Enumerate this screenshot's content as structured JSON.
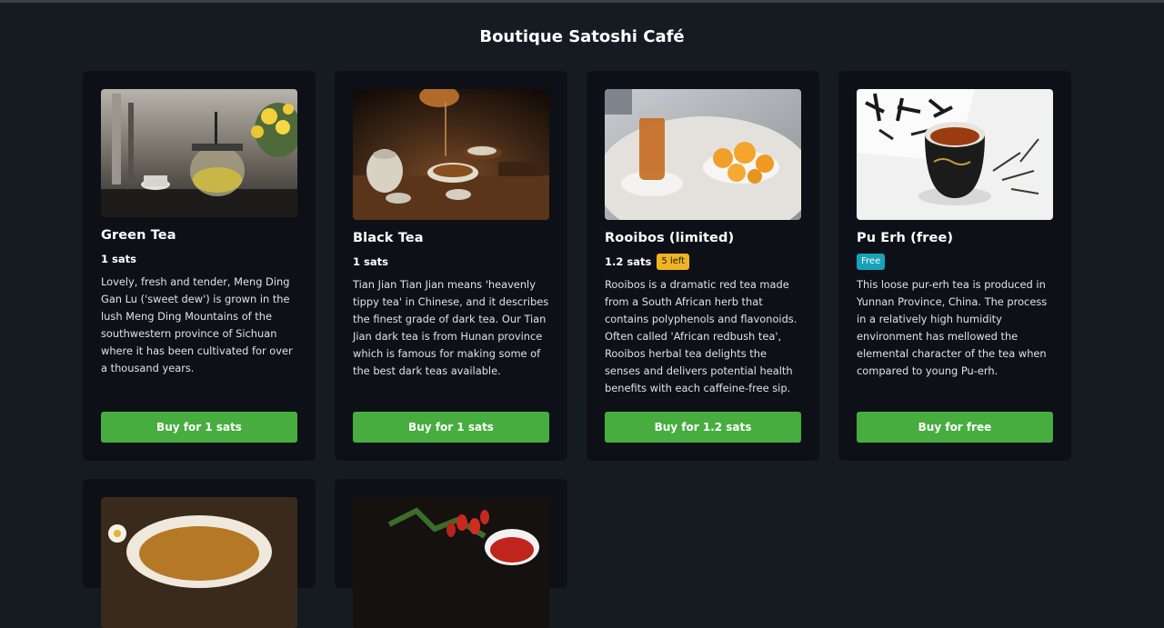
{
  "page": {
    "title": "Boutique Satoshi Café"
  },
  "products": [
    {
      "name": "Green Tea",
      "price": "1 sats",
      "badge": "",
      "description": "Lovely, fresh and tender, Meng Ding Gan Lu ('sweet dew') is grown in the lush Meng Ding Mountains of the southwestern province of Sichuan where it has been cultivated for over a thousand years.",
      "button": "Buy for 1 sats"
    },
    {
      "name": "Black Tea",
      "price": "1 sats",
      "badge": "",
      "description": "Tian Jian Tian Jian means 'heavenly tippy tea' in Chinese, and it describes the finest grade of dark tea. Our Tian Jian dark tea is from Hunan province which is famous for making some of the best dark teas available.",
      "button": "Buy for 1 sats"
    },
    {
      "name": "Rooibos (limited)",
      "price": "1.2 sats",
      "badge": "5 left",
      "description": "Rooibos is a dramatic red tea made from a South African herb that contains polyphenols and flavonoids. Often called 'African redbush tea', Rooibos herbal tea delights the senses and delivers potential health benefits with each caffeine-free sip.",
      "button": "Buy for 1.2 sats"
    },
    {
      "name": "Pu Erh (free)",
      "price": "",
      "badge": "Free",
      "description": "This loose pur-erh tea is produced in Yunnan Province, China. The process in a relatively high humidity environment has mellowed the elemental character of the tea when compared to young Pu-erh.",
      "button": "Buy for free"
    }
  ],
  "colors": {
    "background": "#161b22",
    "card": "#0d1117",
    "buy_button": "#47ad3f",
    "badge_warning": "#f0b323",
    "badge_info": "#17a2b8"
  }
}
